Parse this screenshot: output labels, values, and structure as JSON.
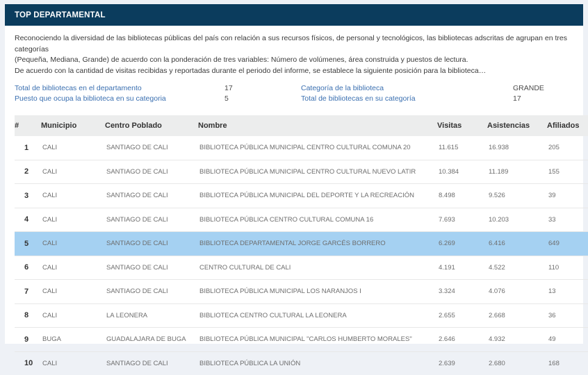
{
  "panel": {
    "title": "TOP DEPARTAMENTAL"
  },
  "description": {
    "line1": "Reconociendo la diversidad de las bibliotecas públicas del país con relación a sus recursos físicos, de personal y tecnológicos, las bibliotecas adscritas de agrupan en tres categorías",
    "line2": "(Pequeña, Mediana, Grande) de acuerdo con la ponderación de tres variables: Número de volúmenes, área construida y puestos de lectura.",
    "line3": "De acuerdo con la cantidad de visitas recibidas y reportadas durante el periodo del informe, se establece la siguiente posición para la biblioteca…"
  },
  "stats": {
    "left": [
      {
        "label": "Total de bibliotecas en el departamento",
        "value": "17"
      },
      {
        "label": "Puesto que ocupa la biblioteca en su categoria",
        "value": "5"
      }
    ],
    "right": [
      {
        "label": "Categoría de la biblioteca",
        "value": "GRANDE"
      },
      {
        "label": "Total de bibliotecas en su categoría",
        "value": "17"
      }
    ]
  },
  "table": {
    "columns": [
      "#",
      "Municipio",
      "Centro Poblado",
      "Nombre",
      "Visitas",
      "Asistencias",
      "Afiliados"
    ],
    "rows": [
      {
        "rank": "1",
        "municipio": "CALI",
        "centro_poblado": "SANTIAGO DE CALI",
        "nombre": "BIBLIOTECA PÚBLICA MUNICIPAL CENTRO CULTURAL COMUNA 20",
        "visitas": "11.615",
        "asistencias": "16.938",
        "afiliados": "205",
        "highlighted": false
      },
      {
        "rank": "2",
        "municipio": "CALI",
        "centro_poblado": "SANTIAGO DE CALI",
        "nombre": "BIBLIOTECA PÚBLICA MUNICIPAL CENTRO CULTURAL NUEVO LATIR",
        "visitas": "10.384",
        "asistencias": "11.189",
        "afiliados": "155",
        "highlighted": false
      },
      {
        "rank": "3",
        "municipio": "CALI",
        "centro_poblado": "SANTIAGO DE CALI",
        "nombre": "BIBLIOTECA PÚBLICA MUNICIPAL DEL DEPORTE Y LA RECREACIÓN",
        "visitas": "8.498",
        "asistencias": "9.526",
        "afiliados": "39",
        "highlighted": false
      },
      {
        "rank": "4",
        "municipio": "CALI",
        "centro_poblado": "SANTIAGO DE CALI",
        "nombre": "BIBLIOTECA PÚBLICA CENTRO CULTURAL COMUNA 16",
        "visitas": "7.693",
        "asistencias": "10.203",
        "afiliados": "33",
        "highlighted": false
      },
      {
        "rank": "5",
        "municipio": "CALI",
        "centro_poblado": "SANTIAGO DE CALI",
        "nombre": "BIBLIOTECA DEPARTAMENTAL JORGE GARCÉS BORRERO",
        "visitas": "6.269",
        "asistencias": "6.416",
        "afiliados": "649",
        "highlighted": true
      },
      {
        "rank": "6",
        "municipio": "CALI",
        "centro_poblado": "SANTIAGO DE CALI",
        "nombre": "CENTRO CULTURAL DE CALI",
        "visitas": "4.191",
        "asistencias": "4.522",
        "afiliados": "110",
        "highlighted": false
      },
      {
        "rank": "7",
        "municipio": "CALI",
        "centro_poblado": "SANTIAGO DE CALI",
        "nombre": "BIBLIOTECA PÚBLICA MUNICIPAL LOS NARANJOS I",
        "visitas": "3.324",
        "asistencias": "4.076",
        "afiliados": "13",
        "highlighted": false
      },
      {
        "rank": "8",
        "municipio": "CALI",
        "centro_poblado": "LA LEONERA",
        "nombre": "BIBLIOTECA CENTRO CULTURAL LA LEONERA",
        "visitas": "2.655",
        "asistencias": "2.668",
        "afiliados": "36",
        "highlighted": false
      },
      {
        "rank": "9",
        "municipio": "BUGA",
        "centro_poblado": "GUADALAJARA DE BUGA",
        "nombre": "BIBLIOTECA PÚBLICA MUNICIPAL \"CARLOS HUMBERTO MORALES\"",
        "visitas": "2.646",
        "asistencias": "4.932",
        "afiliados": "49",
        "highlighted": false
      },
      {
        "rank": "10",
        "municipio": "CALI",
        "centro_poblado": "SANTIAGO DE CALI",
        "nombre": "BIBLIOTECA PÚBLICA LA UNIÓN",
        "visitas": "2.639",
        "asistencias": "2.680",
        "afiliados": "168",
        "highlighted": false
      }
    ]
  },
  "colors": {
    "header_bg": "#0b3c5d",
    "link_blue": "#3a6fb0",
    "highlight_row": "#a5d1f2",
    "table_header_bg": "#eceded"
  }
}
